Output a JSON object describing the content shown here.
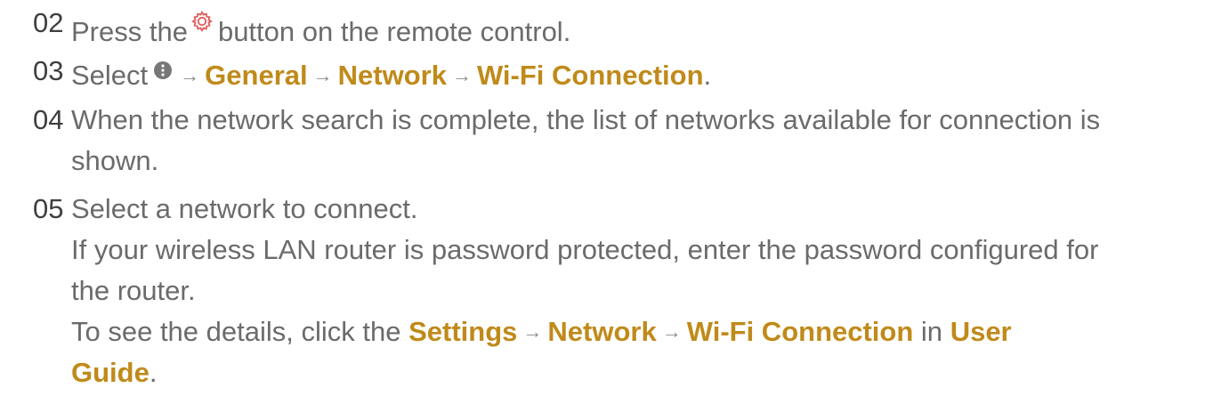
{
  "icons": {
    "settings": "gear-icon",
    "more": "more-options-icon",
    "arrow": "→"
  },
  "colors": {
    "text": "#6b6b6b",
    "number": "#3f3f3f",
    "highlight": "#c08a1a",
    "gear": "#e05a5a",
    "dot": "#777777"
  },
  "steps": [
    {
      "number": "02",
      "parts": [
        "Press the",
        "button on the remote control."
      ]
    },
    {
      "number": "03",
      "select": "Select",
      "items": [
        "General",
        "Network",
        "Wi-Fi Connection"
      ],
      "end": "."
    },
    {
      "number": "04",
      "lines": [
        "When the network search is complete, the list of networks available for connection is",
        "shown."
      ]
    },
    {
      "number": "05",
      "lines": [
        "Select a network to connect.",
        "If your wireless LAN router is password protected, enter the password configured for",
        "the router."
      ],
      "details": {
        "prefix": "To see the details, click the",
        "items": [
          "Settings",
          "Network",
          "Wi-Fi Connection"
        ],
        "middle": "in",
        "guide1": "User",
        "guide2": "Guide",
        "end": "."
      }
    }
  ]
}
